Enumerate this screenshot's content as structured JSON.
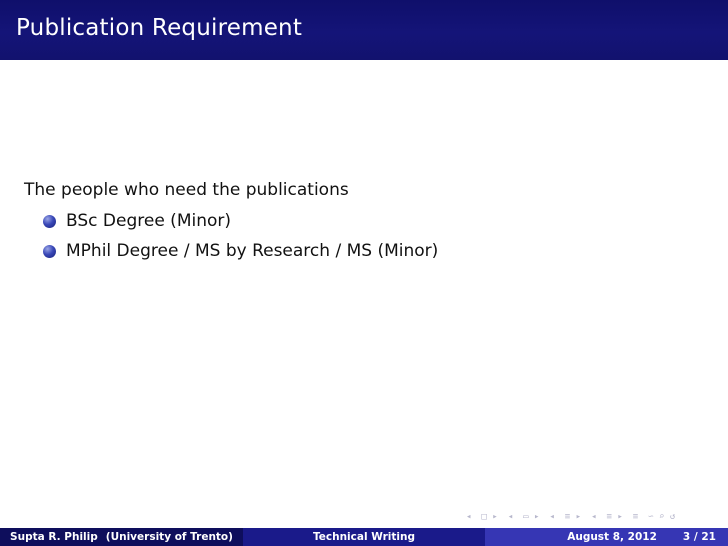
{
  "slide": {
    "title": "Publication Requirement",
    "intro": "The people who need the publications",
    "bullets": [
      "BSc Degree (Minor)",
      "MPhil Degree / MS by Research / MS (Minor)"
    ]
  },
  "footer": {
    "author": "Supta R. Philip",
    "institution": "(University of Trento)",
    "short_title": "Technical Writing",
    "date": "August 8, 2012",
    "page": "3 / 21"
  },
  "nav_icons": [
    "nav-prev-slide-icon",
    "nav-next-slide-icon",
    "nav-prev-frame-icon",
    "nav-next-frame-icon",
    "nav-prev-section-icon",
    "nav-next-section-icon",
    "nav-prev-subsection-icon",
    "nav-next-subsection-icon",
    "nav-align-icon",
    "nav-search-icon"
  ],
  "colors": {
    "title_bar": "#141478",
    "footer_left": "#0e0e5c",
    "footer_mid": "#1a1a8a",
    "footer_right": "#3636b4",
    "bullet_ball": "#3a48b8"
  }
}
